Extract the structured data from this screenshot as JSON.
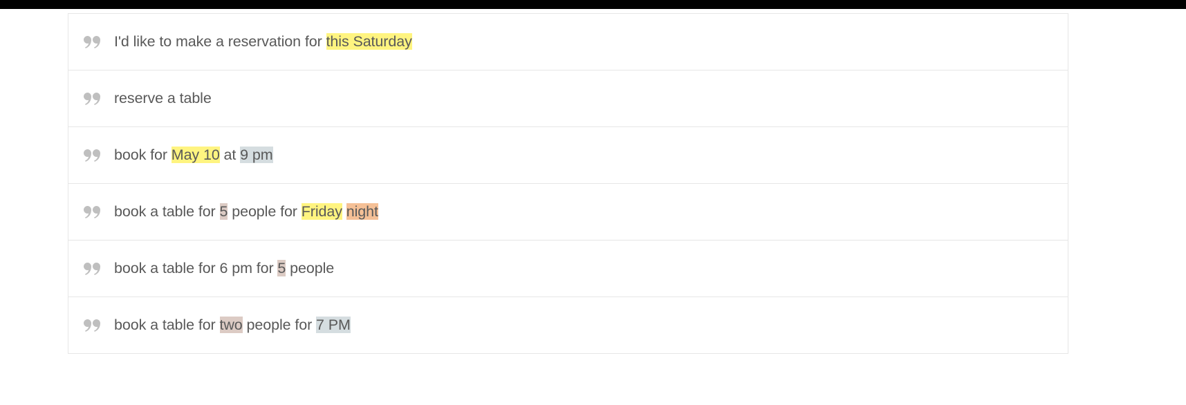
{
  "highlight_colors": {
    "yellow": "#fff480",
    "grey": "#d5dde0",
    "tan": "#dccbc4",
    "orange": "#f5c096"
  },
  "phrases": [
    {
      "segments": [
        {
          "text": "I'd like to make a reservation for ",
          "hl": null
        },
        {
          "text": "this Saturday",
          "hl": "yellow"
        }
      ]
    },
    {
      "segments": [
        {
          "text": "reserve a table",
          "hl": null
        }
      ]
    },
    {
      "segments": [
        {
          "text": "book for ",
          "hl": null
        },
        {
          "text": "May 10",
          "hl": "yellow"
        },
        {
          "text": " at ",
          "hl": null
        },
        {
          "text": "9 pm",
          "hl": "grey"
        }
      ]
    },
    {
      "segments": [
        {
          "text": "book a table for ",
          "hl": null
        },
        {
          "text": "5",
          "hl": "tan"
        },
        {
          "text": " people for ",
          "hl": null
        },
        {
          "text": "Friday",
          "hl": "yellow"
        },
        {
          "text": " ",
          "hl": null
        },
        {
          "text": "night",
          "hl": "orange"
        }
      ]
    },
    {
      "segments": [
        {
          "text": "book a table for 6 pm for ",
          "hl": null
        },
        {
          "text": "5",
          "hl": "tan"
        },
        {
          "text": " people",
          "hl": null
        }
      ]
    },
    {
      "segments": [
        {
          "text": "book a table for ",
          "hl": null
        },
        {
          "text": "two",
          "hl": "tan"
        },
        {
          "text": " people for ",
          "hl": null
        },
        {
          "text": "7 PM",
          "hl": "grey"
        }
      ]
    }
  ]
}
